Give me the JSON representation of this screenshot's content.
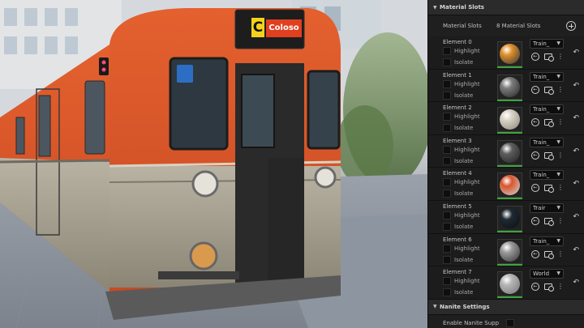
{
  "viewport": {
    "sign_letter": "C",
    "sign_text": "Coloso"
  },
  "panel": {
    "material_slots": {
      "title": "Material Slots",
      "slots_label": "Material Slots",
      "slots_count": "8 Material Slots",
      "elements": [
        {
          "name": "Element 0",
          "highlight": "Highlight",
          "isolate": "Isolate",
          "material": "Train_",
          "swatch": "#e0902a",
          "swatch_b": "#3a3a3a"
        },
        {
          "name": "Element 1",
          "highlight": "Highlight",
          "isolate": "Isolate",
          "material": "Train_",
          "swatch": "#7c7c7c",
          "swatch_b": "#2a2a2a"
        },
        {
          "name": "Element 2",
          "highlight": "Highlight",
          "isolate": "Isolate",
          "material": "Train_",
          "swatch": "#d8d3c4",
          "swatch_b": "#8e8a7e"
        },
        {
          "name": "Element 3",
          "highlight": "Highlight",
          "isolate": "Isolate",
          "material": "Train_",
          "swatch": "#5e5e5e",
          "swatch_b": "#262626"
        },
        {
          "name": "Element 4",
          "highlight": "Highlight",
          "isolate": "Isolate",
          "material": "Train_",
          "swatch": "#d8552c",
          "swatch_b": "#cfcfcf"
        },
        {
          "name": "Element 5",
          "highlight": "Highlight",
          "isolate": "Isolate",
          "material": "Trair",
          "swatch": "#1f2a33",
          "swatch_b": "#0c1014"
        },
        {
          "name": "Element 6",
          "highlight": "Highlight",
          "isolate": "Isolate",
          "material": "Train_",
          "swatch": "#9a9a9a",
          "swatch_b": "#3a3a3a"
        },
        {
          "name": "Element 7",
          "highlight": "Highlight",
          "isolate": "Isolate",
          "material": "World",
          "swatch": "#b5b5b5",
          "swatch_b": "#7a7a7a"
        }
      ]
    },
    "nanite": {
      "title": "Nanite Settings",
      "enable_label": "Enable Nanite Supp"
    }
  },
  "colors": {
    "accent_green": "#3fa43f",
    "train_orange": "#d9532b",
    "panel_bg": "#1a1a1a"
  }
}
